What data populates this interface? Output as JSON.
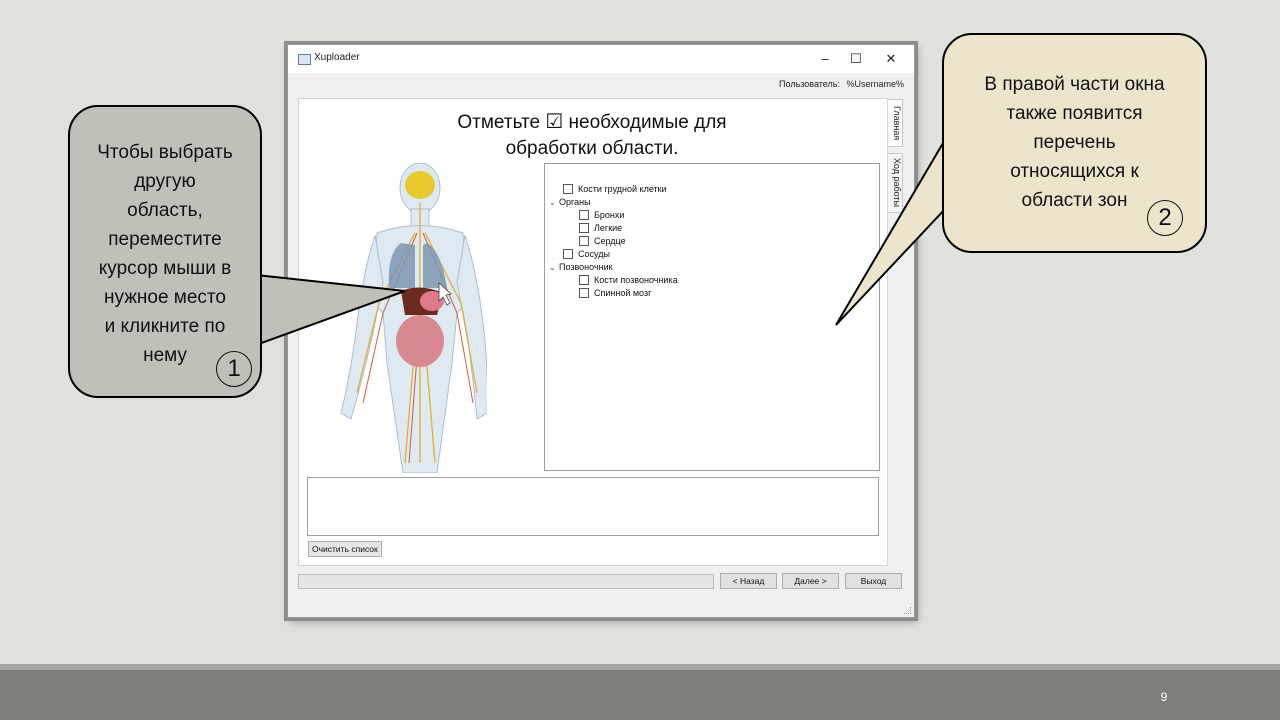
{
  "window": {
    "title": "Xuploader",
    "controls": {
      "minimize": "–",
      "maximize": "☐",
      "close": "✕"
    },
    "user_label": "Пользователь:",
    "username": "%Username%",
    "side_tabs": [
      {
        "label": "Главная",
        "active": true
      },
      {
        "label": "Ход работы",
        "active": false
      }
    ],
    "heading_line1_a": "Отметьте",
    "heading_check": "☑",
    "heading_line1_b": "необходимые для",
    "heading_line2": "обработки области.",
    "tree": [
      {
        "label": "Кости грудной клетки",
        "level": 0,
        "checkbox": true,
        "expanded": null
      },
      {
        "label": "Органы",
        "level": 0,
        "checkbox": false,
        "expanded": true
      },
      {
        "label": "Бронхи",
        "level": 1,
        "checkbox": true,
        "expanded": null
      },
      {
        "label": "Легкие",
        "level": 1,
        "checkbox": true,
        "expanded": null
      },
      {
        "label": "Сердце",
        "level": 1,
        "checkbox": true,
        "expanded": null
      },
      {
        "label": "Сосуды",
        "level": 0,
        "checkbox": true,
        "expanded": null
      },
      {
        "label": "Позвоночник",
        "level": 0,
        "checkbox": false,
        "expanded": true
      },
      {
        "label": "Кости позвоночника",
        "level": 1,
        "checkbox": true,
        "expanded": null
      },
      {
        "label": "Спинной мозг",
        "level": 1,
        "checkbox": true,
        "expanded": null
      }
    ],
    "clear_button": "Очистить список",
    "back_button": "< Назад",
    "next_button": "Далее >",
    "exit_button": "Выход"
  },
  "callouts": [
    {
      "lines": [
        "Чтобы выбрать",
        "другую",
        "область,",
        "переместите",
        "курсор мыши в",
        "нужное место",
        "и кликните по",
        "нему"
      ],
      "number": "1"
    },
    {
      "lines": [
        "В правой части окна",
        "также появится",
        "перечень",
        "относящихся к",
        "области зон"
      ],
      "number": "2"
    }
  ],
  "slide": {
    "page_number": "9"
  },
  "colors": {
    "callout_1_bg": "#bfc1b8",
    "callout_2_bg": "#ece5cb",
    "footer": "#7f7f79"
  }
}
